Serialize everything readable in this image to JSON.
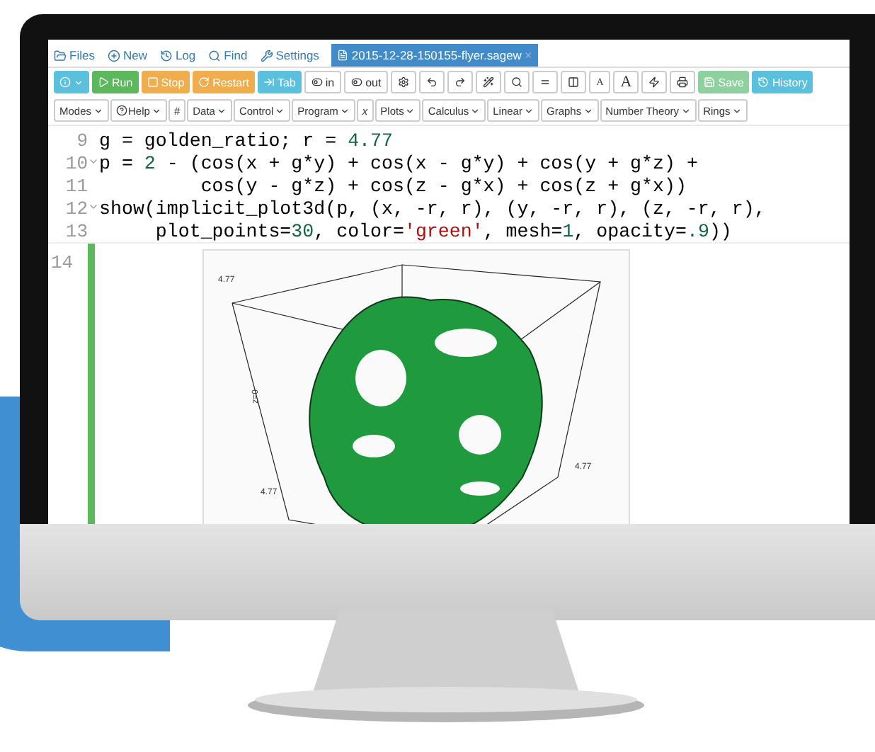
{
  "top_bar": {
    "links": [
      {
        "label": "Files"
      },
      {
        "label": "New"
      },
      {
        "label": "Log"
      },
      {
        "label": "Find"
      },
      {
        "label": "Settings"
      }
    ],
    "file_tab": {
      "label": "2015-12-28-150155-flyer.sagew",
      "selected": true,
      "close": "×"
    }
  },
  "toolbar": [
    {
      "color": "#5bc0de",
      "caret": true
    },
    {
      "label": "Run",
      "color": "#5cb85c",
      "caret": false
    },
    {
      "label": "Stop",
      "color": "#f0ad4e",
      "caret": false
    },
    {
      "label": "Restart",
      "color": "#f0ad4e",
      "caret": false
    },
    {
      "label": "Tab",
      "color": "#5bc0de",
      "caret": false
    },
    {
      "label": "in",
      "color": "#ffffff",
      "caret": false
    },
    {
      "label": "out",
      "color": "#ffffff",
      "caret": false
    },
    {
      "color": "#ffffff",
      "caret": false
    },
    {
      "color": "#ffffff",
      "caret": false
    },
    {
      "color": "#ffffff",
      "caret": false
    },
    {
      "color": "#ffffff",
      "caret": false
    },
    {
      "color": "#ffffff",
      "caret": false
    },
    {
      "color": "#ffffff",
      "caret": false
    },
    {
      "color": "#ffffff",
      "caret": false
    },
    {
      "label": "A",
      "color": "#ffffff",
      "caret": false
    },
    {
      "label": "A",
      "color": "#ffffff",
      "caret": false
    },
    {
      "color": "#ffffff",
      "caret": false
    },
    {
      "color": "#ffffff",
      "caret": false
    },
    {
      "label": "Save",
      "color": "#8fd19e",
      "caret": false
    },
    {
      "label": "History",
      "color": "#5bc0de",
      "caret": false
    }
  ],
  "menus": [
    {
      "label": "Modes",
      "caret": true
    },
    {
      "label": "Help",
      "caret": true
    },
    {
      "label": "#",
      "caret": false
    },
    {
      "label": "Data",
      "caret": true
    },
    {
      "label": "Control",
      "caret": true
    },
    {
      "label": "Program",
      "caret": true
    },
    {
      "label": "x",
      "caret": false
    },
    {
      "label": "Plots",
      "caret": true
    },
    {
      "label": "Calculus",
      "caret": true
    },
    {
      "label": "Linear",
      "caret": true
    },
    {
      "label": "Graphs",
      "caret": true
    },
    {
      "label": "Number Theory",
      "caret": true
    },
    {
      "label": "Rings",
      "caret": true
    }
  ],
  "code": [
    {
      "number": "9",
      "foldable": false,
      "tokens": [
        {
          "kind": "plain",
          "text": "g = golden_ratio; r = "
        },
        {
          "kind": "number",
          "text": "4.77"
        }
      ]
    },
    {
      "number": "10",
      "foldable": true,
      "tokens": [
        {
          "kind": "plain",
          "text": "p = "
        },
        {
          "kind": "number",
          "text": "2"
        },
        {
          "kind": "plain",
          "text": " - (cos(x + g*y) + cos(x - g*y) + cos(y + g*z) +"
        }
      ]
    },
    {
      "number": "11",
      "foldable": false,
      "tokens": [
        {
          "kind": "plain",
          "text": "         cos(y - g*z) + cos(z - g*x) + cos(z + g*x))"
        }
      ]
    },
    {
      "number": "12",
      "foldable": true,
      "tokens": [
        {
          "kind": "plain",
          "text": "show(implicit_plot3d(p, (x, -r, r), (y, -r, r), (z, -r, r),"
        }
      ]
    },
    {
      "number": "13",
      "foldable": false,
      "tokens": [
        {
          "kind": "plain",
          "text": "     plot_points="
        },
        {
          "kind": "number",
          "text": "30"
        },
        {
          "kind": "plain",
          "text": ", color="
        },
        {
          "kind": "string",
          "text": "'green'"
        },
        {
          "kind": "plain",
          "text": ", mesh="
        },
        {
          "kind": "number",
          "text": "1"
        },
        {
          "kind": "plain",
          "text": ", opacity="
        },
        {
          "kind": "number",
          "text": ".9"
        },
        {
          "kind": "plain",
          "text": "))"
        }
      ]
    }
  ],
  "output_cell": {
    "number": "14",
    "plot_labels": [
      "4.77",
      "z=0",
      "4.77",
      "4.77"
    ]
  }
}
